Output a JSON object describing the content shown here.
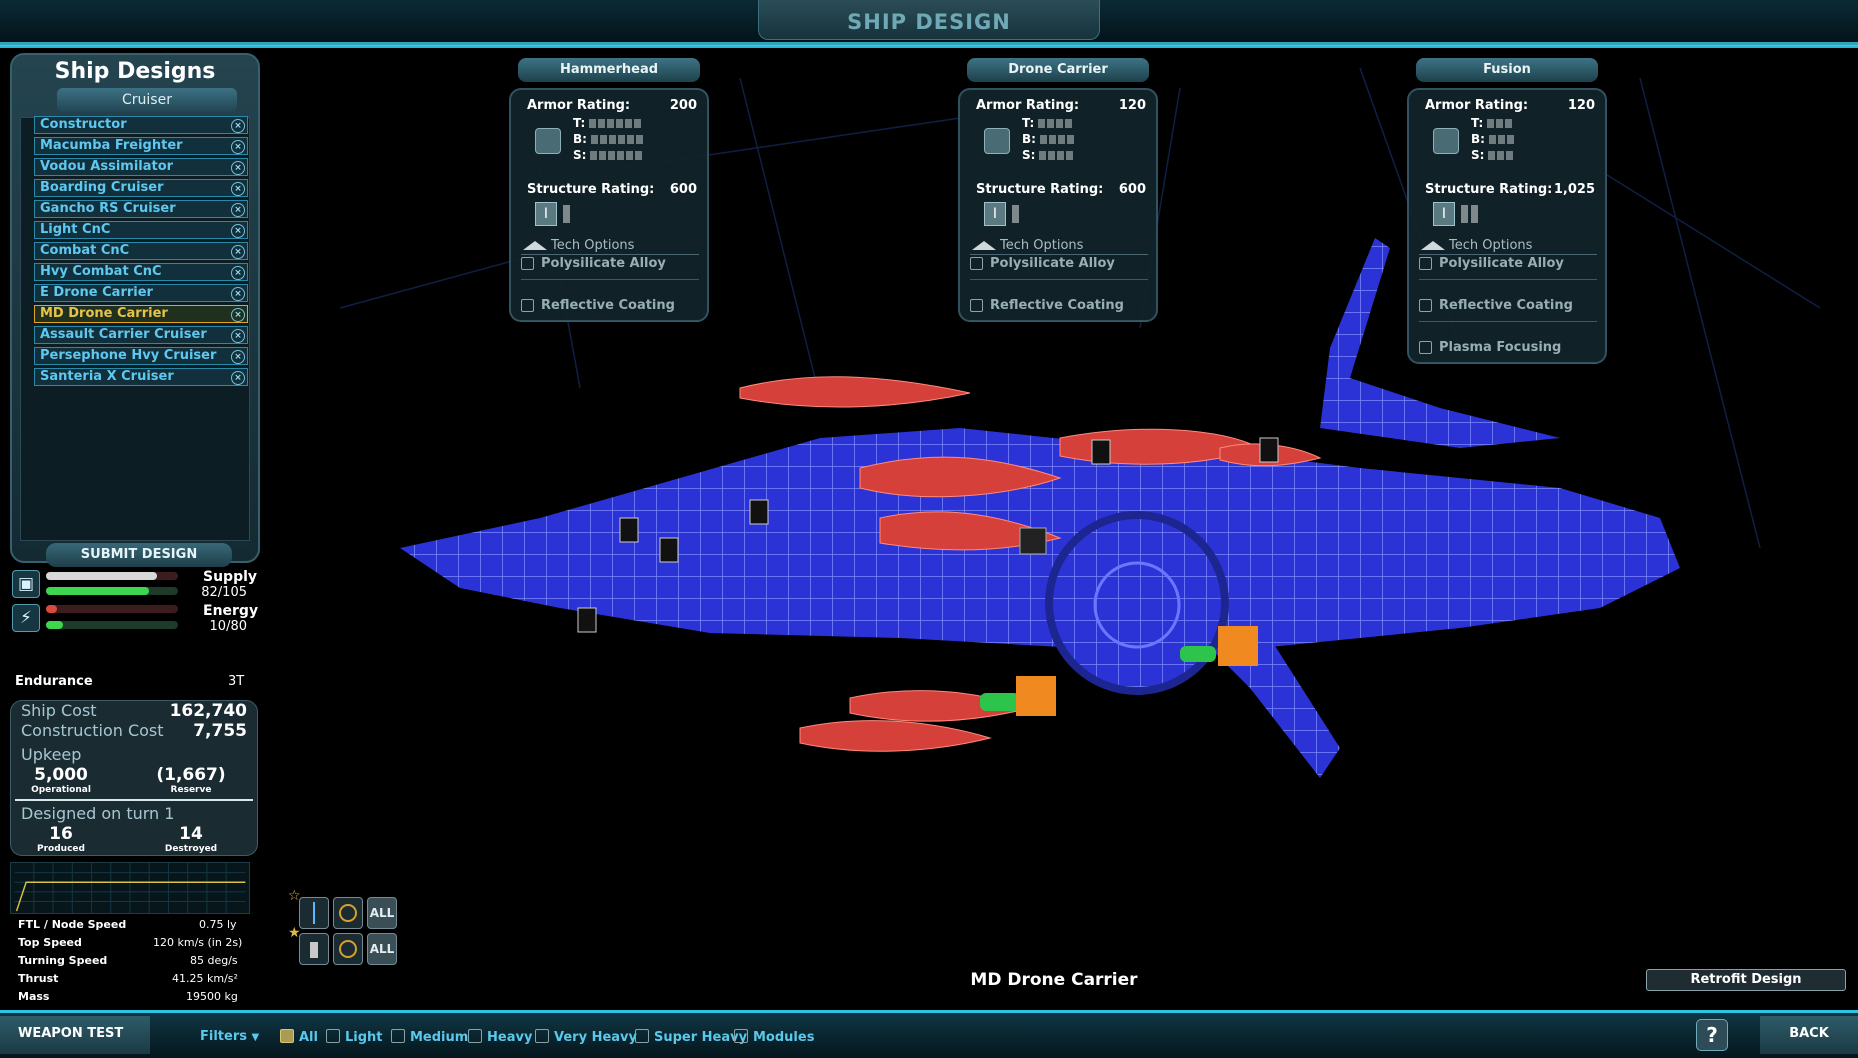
{
  "window": {
    "title": "SHIP DESIGN"
  },
  "designs_panel": {
    "title": "Ship Designs",
    "class_tab": "Cruiser",
    "items": [
      {
        "label": "Constructor",
        "selected": false
      },
      {
        "label": "Macumba Freighter",
        "selected": false
      },
      {
        "label": "Vodou Assimilator",
        "selected": false
      },
      {
        "label": "Boarding Cruiser",
        "selected": false
      },
      {
        "label": "Gancho RS Cruiser",
        "selected": false
      },
      {
        "label": "Light CnC",
        "selected": false
      },
      {
        "label": "Combat CnC",
        "selected": false
      },
      {
        "label": "Hvy Combat CnC",
        "selected": false
      },
      {
        "label": "E Drone Carrier",
        "selected": false
      },
      {
        "label": "MD Drone Carrier",
        "selected": true
      },
      {
        "label": "Assault Carrier Cruiser",
        "selected": false
      },
      {
        "label": "Persephone Hvy Cruiser",
        "selected": false
      },
      {
        "label": "Santeria X Cruiser",
        "selected": false
      }
    ],
    "submit_label": "SUBMIT DESIGN"
  },
  "resources": {
    "supply": {
      "label": "Supply",
      "value": "82/105",
      "fraction": 0.78
    },
    "energy": {
      "label": "Energy",
      "value": "10/80",
      "fraction": 0.125
    }
  },
  "endurance": {
    "label": "Endurance",
    "value": "3T"
  },
  "costs": {
    "ship_cost_label": "Ship Cost",
    "ship_cost": "162,740",
    "construction_cost_label": "Construction Cost",
    "construction_cost": "7,755",
    "upkeep_label": "Upkeep",
    "operational_value": "5,000",
    "operational_label": "Operational",
    "reserve_value": "(1,667)",
    "reserve_label": "Reserve",
    "designed_label": "Designed on turn 1",
    "produced_value": "16",
    "produced_label": "Produced",
    "destroyed_value": "14",
    "destroyed_label": "Destroyed"
  },
  "stats": [
    {
      "label": "FTL / Node Speed",
      "value": "0.75 ly"
    },
    {
      "label": "Top Speed",
      "value": "120 km/s (in 2s)"
    },
    {
      "label": "Turning Speed",
      "value": "85 deg/s"
    },
    {
      "label": "Thrust",
      "value": "41.25 km/s²"
    },
    {
      "label": "Mass",
      "value": "19500 kg"
    }
  ],
  "sections": [
    {
      "name": "Hammerhead",
      "armor_label": "Armor Rating:",
      "armor": "200",
      "structure_label": "Structure Rating:",
      "structure": "600",
      "tech_label": "Tech Options",
      "options": [
        "Polysilicate Alloy",
        "Reflective Coating"
      ]
    },
    {
      "name": "Drone Carrier",
      "armor_label": "Armor Rating:",
      "armor": "120",
      "structure_label": "Structure Rating:",
      "structure": "600",
      "tech_label": "Tech Options",
      "options": [
        "Polysilicate Alloy",
        "Reflective Coating"
      ]
    },
    {
      "name": "Fusion",
      "armor_label": "Armor Rating:",
      "armor": "120",
      "structure_label": "Structure Rating:",
      "structure": "1,025",
      "tech_label": "Tech Options",
      "options": [
        "Polysilicate Alloy",
        "Reflective Coating",
        "Plasma Focusing"
      ]
    }
  ],
  "tbs": {
    "t": "T:",
    "b": "B:",
    "s": "S:"
  },
  "weapon_groups": {
    "all_label": "ALL"
  },
  "ship_name": "MD Drone Carrier",
  "retrofit_label": "Retrofit Design",
  "bottom": {
    "weapon_test": "WEAPON TEST",
    "filters": "Filters",
    "filter_items": [
      {
        "label": "All",
        "checked": true
      },
      {
        "label": "Light",
        "checked": false
      },
      {
        "label": "Medium",
        "checked": false
      },
      {
        "label": "Heavy",
        "checked": false
      },
      {
        "label": "Very Heavy",
        "checked": false
      },
      {
        "label": "Super Heavy",
        "checked": false
      },
      {
        "label": "Modules",
        "checked": false
      }
    ],
    "help": "?",
    "back": "BACK"
  },
  "colors": {
    "accent": "#33c3e2",
    "list_text": "#5ec8f0",
    "selected_border": "#e1a42a",
    "hull": "#3a45e0",
    "weapon_red": "#e0403a"
  }
}
